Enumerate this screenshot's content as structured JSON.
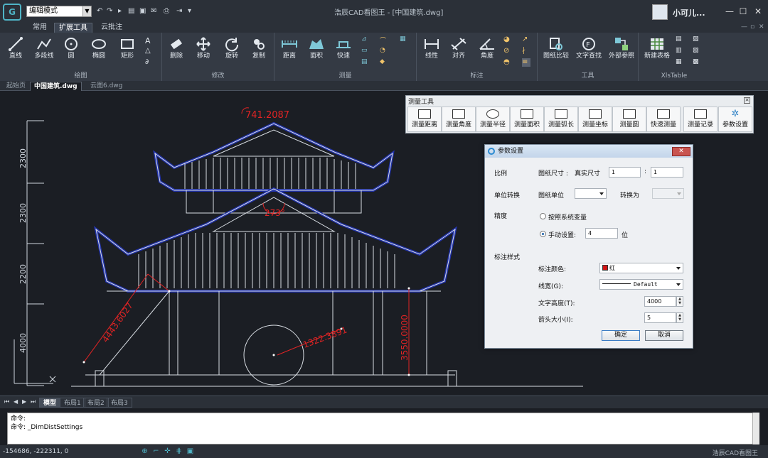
{
  "window": {
    "title": "浩辰CAD看图王 - [中国建筑.dwg]",
    "mode": "编辑模式",
    "username": "小可儿..."
  },
  "menu_tabs": [
    "常用",
    "扩展工具",
    "云批注"
  ],
  "ribbon": {
    "groups": [
      {
        "label": "绘图",
        "buttons": [
          "直线",
          "多段线",
          "圆",
          "椭圆",
          "矩形"
        ]
      },
      {
        "label": "修改",
        "buttons": [
          "删除",
          "移动",
          "旋转",
          "复制"
        ]
      },
      {
        "label": "测量",
        "buttons": [
          "距离",
          "面积",
          "快速"
        ]
      },
      {
        "label": "标注",
        "buttons": [
          "线性",
          "对齐",
          "角度"
        ]
      },
      {
        "label": "工具",
        "buttons": [
          "图纸比较",
          "文字查找",
          "外部参照"
        ]
      },
      {
        "label": "XlsTable",
        "buttons": [
          "新建表格"
        ]
      }
    ]
  },
  "doc_tabs": [
    "起始页",
    "中国建筑.dwg",
    "云图6.dwg"
  ],
  "measure_tool": {
    "title": "测量工具",
    "buttons": [
      "测量距离",
      "测量角度",
      "测量半径",
      "测量面积",
      "测量弧长",
      "测量坐标",
      "测量圆",
      "快速测量",
      "测量记录",
      "参数设置"
    ]
  },
  "dialog": {
    "title": "参数设置",
    "scale_label": "比例",
    "paper_size_label": "图纸尺寸 :",
    "real_size_label": "真实尺寸",
    "paper_value": "1",
    "real_value": "1",
    "unit_label": "单位转换",
    "paper_unit_label": "图纸单位",
    "convert_label": "转换为",
    "precision_label": "精度",
    "radio_system": "按照系统变量",
    "radio_manual": "手动设置:",
    "manual_value": "4",
    "manual_unit": "位",
    "style_label": "标注样式",
    "color_label": "标注颜色:",
    "color_value": "红",
    "color_hex": "#d21414",
    "linewidth_label": "线宽(G):",
    "linewidth_value": "Default",
    "text_height_label": "文字高度(T):",
    "text_height_value": "4000",
    "arrow_label": "箭头大小(I):",
    "arrow_value": "5",
    "ok_label": "确定",
    "cancel_label": "取消"
  },
  "drawing": {
    "dims": [
      "741.2087",
      "273°",
      "4443.6027",
      "3550.0000",
      "1322.3891"
    ],
    "ruler_labels": [
      "2300",
      "2300",
      "2200",
      "4000"
    ]
  },
  "layout_tabs": [
    "模型",
    "布局1",
    "布局2",
    "布局3"
  ],
  "command": [
    "命令:",
    "命令: _DimDistSettings"
  ],
  "status": {
    "coords": "-154686, -222311, 0",
    "app": "浩辰CAD看图王"
  },
  "colors": {
    "accent": "#4fb4c6",
    "dim": "#e02424",
    "outline": "#2233aa"
  }
}
